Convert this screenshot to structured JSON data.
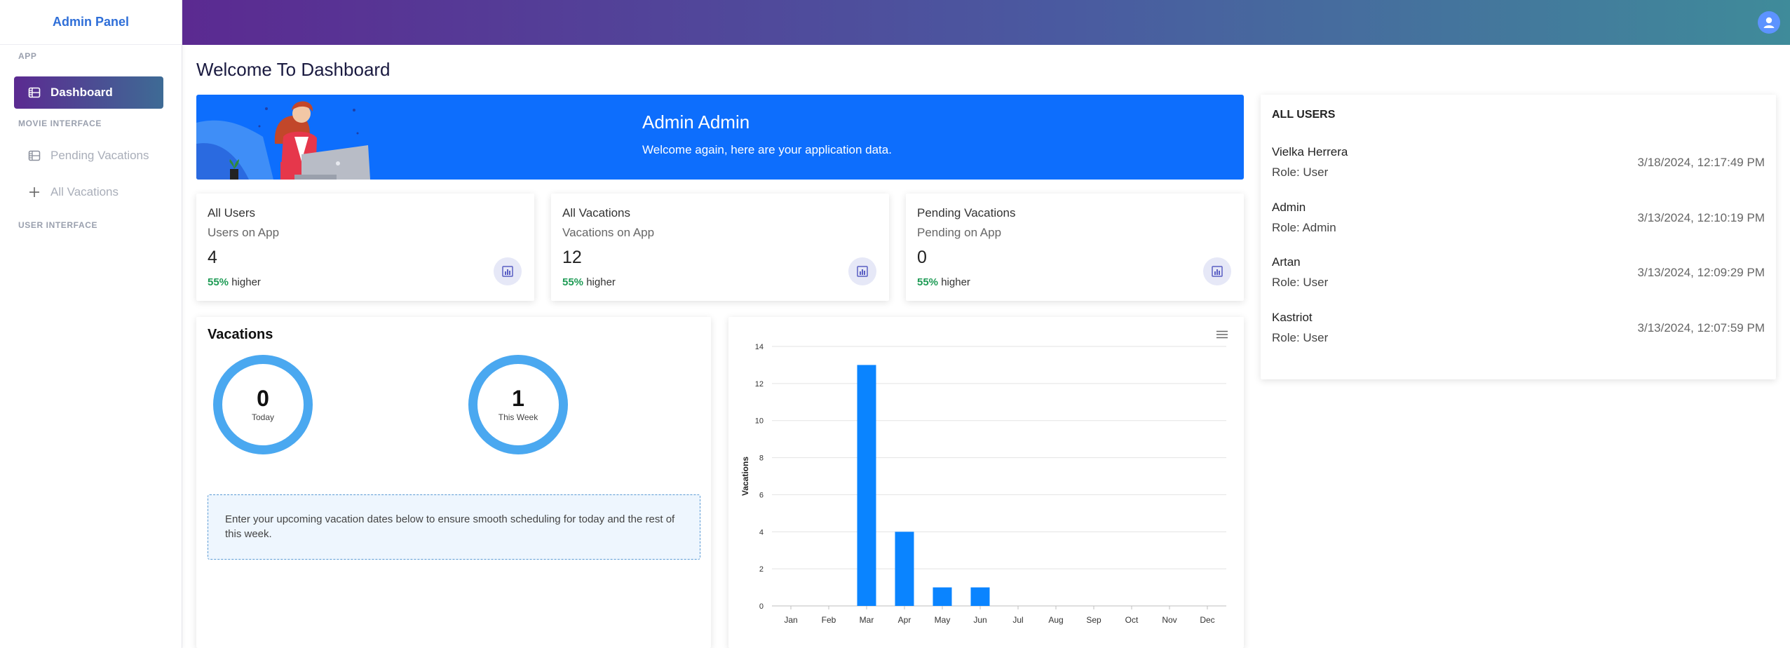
{
  "sidebar": {
    "brand": "Admin Panel",
    "sections": {
      "app": "APP",
      "movie": "MOVIE INTERFACE",
      "user": "USER INTERFACE"
    },
    "items": [
      {
        "label": "Dashboard",
        "icon": "film-icon",
        "active": true
      },
      {
        "label": "Pending Vacations",
        "icon": "film-icon",
        "active": false
      },
      {
        "label": "All Vacations",
        "icon": "plus-icon",
        "active": false
      }
    ]
  },
  "header": {
    "avatar_icon": "user-avatar-icon"
  },
  "page_title": "Welcome To Dashboard",
  "banner": {
    "name": "Admin Admin",
    "message": "Welcome again, here are your application data."
  },
  "stats": [
    {
      "title": "All Users",
      "subtitle": "Users on App",
      "value": "4",
      "percent": "55%",
      "suffix": "higher",
      "icon": "chart-icon"
    },
    {
      "title": "All Vacations",
      "subtitle": "Vacations on App",
      "value": "12",
      "percent": "55%",
      "suffix": "higher",
      "icon": "chart-icon"
    },
    {
      "title": "Pending Vacations",
      "subtitle": "Pending on App",
      "value": "0",
      "percent": "55%",
      "suffix": "higher",
      "icon": "chart-icon"
    }
  ],
  "all_users": {
    "title": "ALL USERS",
    "users": [
      {
        "name": "Vielka Herrera",
        "role": "Role: User",
        "date": "3/18/2024, 12:17:49 PM"
      },
      {
        "name": "Admin",
        "role": "Role: Admin",
        "date": "3/13/2024, 12:10:19 PM"
      },
      {
        "name": "Artan",
        "role": "Role: User",
        "date": "3/13/2024, 12:09:29 PM"
      },
      {
        "name": "Kastriot",
        "role": "Role: User",
        "date": "3/13/2024, 12:07:59 PM"
      }
    ]
  },
  "vacations": {
    "title": "Vacations",
    "today": {
      "value": "0",
      "label": "Today"
    },
    "week": {
      "value": "1",
      "label": "This Week"
    },
    "note": "Enter your upcoming vacation dates below to ensure smooth scheduling for today and the rest of this week."
  },
  "colors": {
    "accent": "#0d6efd",
    "bar": "#0a84ff",
    "ring": "#4aa8f0",
    "positive": "#1e9b55"
  },
  "chart_data": {
    "type": "bar",
    "categories": [
      "Jan",
      "Feb",
      "Mar",
      "Apr",
      "May",
      "Jun",
      "Jul",
      "Aug",
      "Sep",
      "Oct",
      "Nov",
      "Dec"
    ],
    "values": [
      0,
      0,
      13,
      4,
      1,
      1,
      0,
      0,
      0,
      0,
      0,
      0
    ],
    "title": "",
    "xlabel": "",
    "ylabel": "Vacations",
    "ylim": [
      0,
      14
    ],
    "yticks": [
      0,
      2,
      4,
      6,
      8,
      10,
      12,
      14
    ],
    "grid": true,
    "legend": "none"
  }
}
